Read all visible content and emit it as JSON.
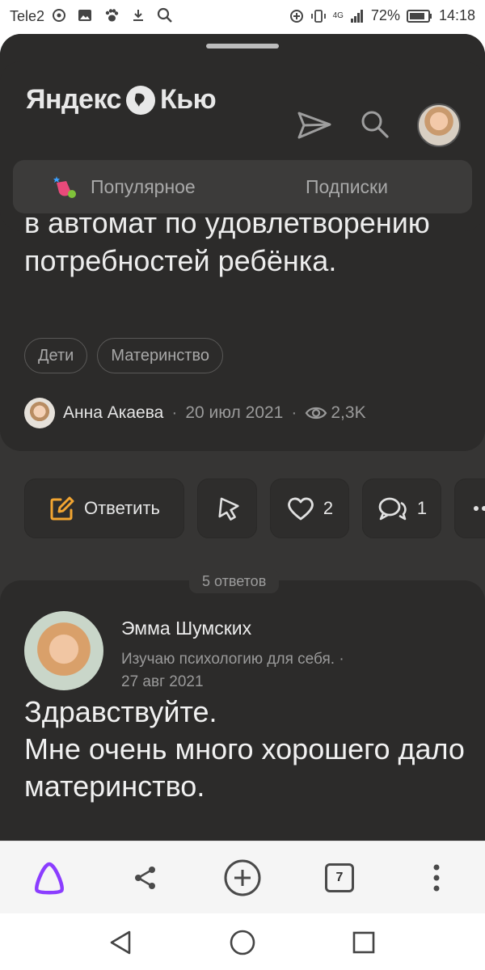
{
  "status_bar": {
    "carrier": "Tele2",
    "network": "4G",
    "battery": "72%",
    "time": "14:18"
  },
  "app": {
    "logo_text_left": "Яндекс",
    "logo_text_right": "Кью"
  },
  "tabs": [
    {
      "label": "Популярное",
      "active": true
    },
    {
      "label": "Подписки",
      "active": false
    }
  ],
  "question": {
    "text": "в автомат по удовлетворению потребностей ребёнка.",
    "tags": [
      "Дети",
      "Материнство"
    ],
    "author": "Анна Акаева",
    "date": "20 июл 2021",
    "views": "2,3K"
  },
  "actions": {
    "reply_label": "Ответить",
    "likes": "2",
    "comments": "1"
  },
  "answers": {
    "count_label": "5 ответов",
    "first": {
      "author": "Эмма Шумских",
      "bio": "Изучаю психологию для себя. ·",
      "date": "27 авг 2021",
      "line1": "Здравствуйте.",
      "line2": "Мне очень много хорошего дало материнство."
    }
  },
  "browser_bar": {
    "tabs_count": "7"
  },
  "colors": {
    "dark_bg": "#2c2b2a",
    "sheet_bg": "#363534",
    "accent_orange": "#f2a531",
    "alice_purple": "#8b3dff"
  }
}
